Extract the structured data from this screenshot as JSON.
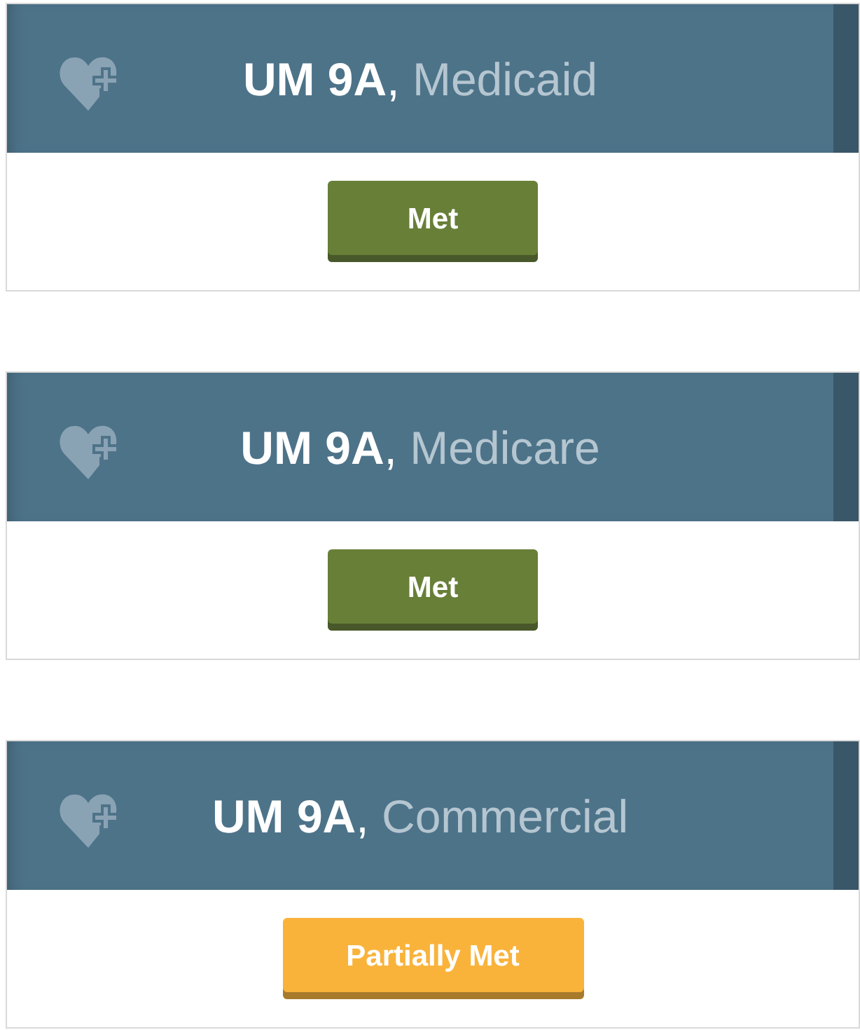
{
  "measures": [
    {
      "code": "UM 9A",
      "separator": ",",
      "plan": "Medicaid",
      "status": {
        "kind": "met",
        "label": "Met"
      }
    },
    {
      "code": "UM 9A",
      "separator": ",",
      "plan": "Medicare",
      "status": {
        "kind": "met",
        "label": "Met"
      }
    },
    {
      "code": "UM 9A",
      "separator": ",",
      "plan": "Commercial",
      "status": {
        "kind": "partially_met",
        "label": "Partially Met"
      }
    }
  ]
}
